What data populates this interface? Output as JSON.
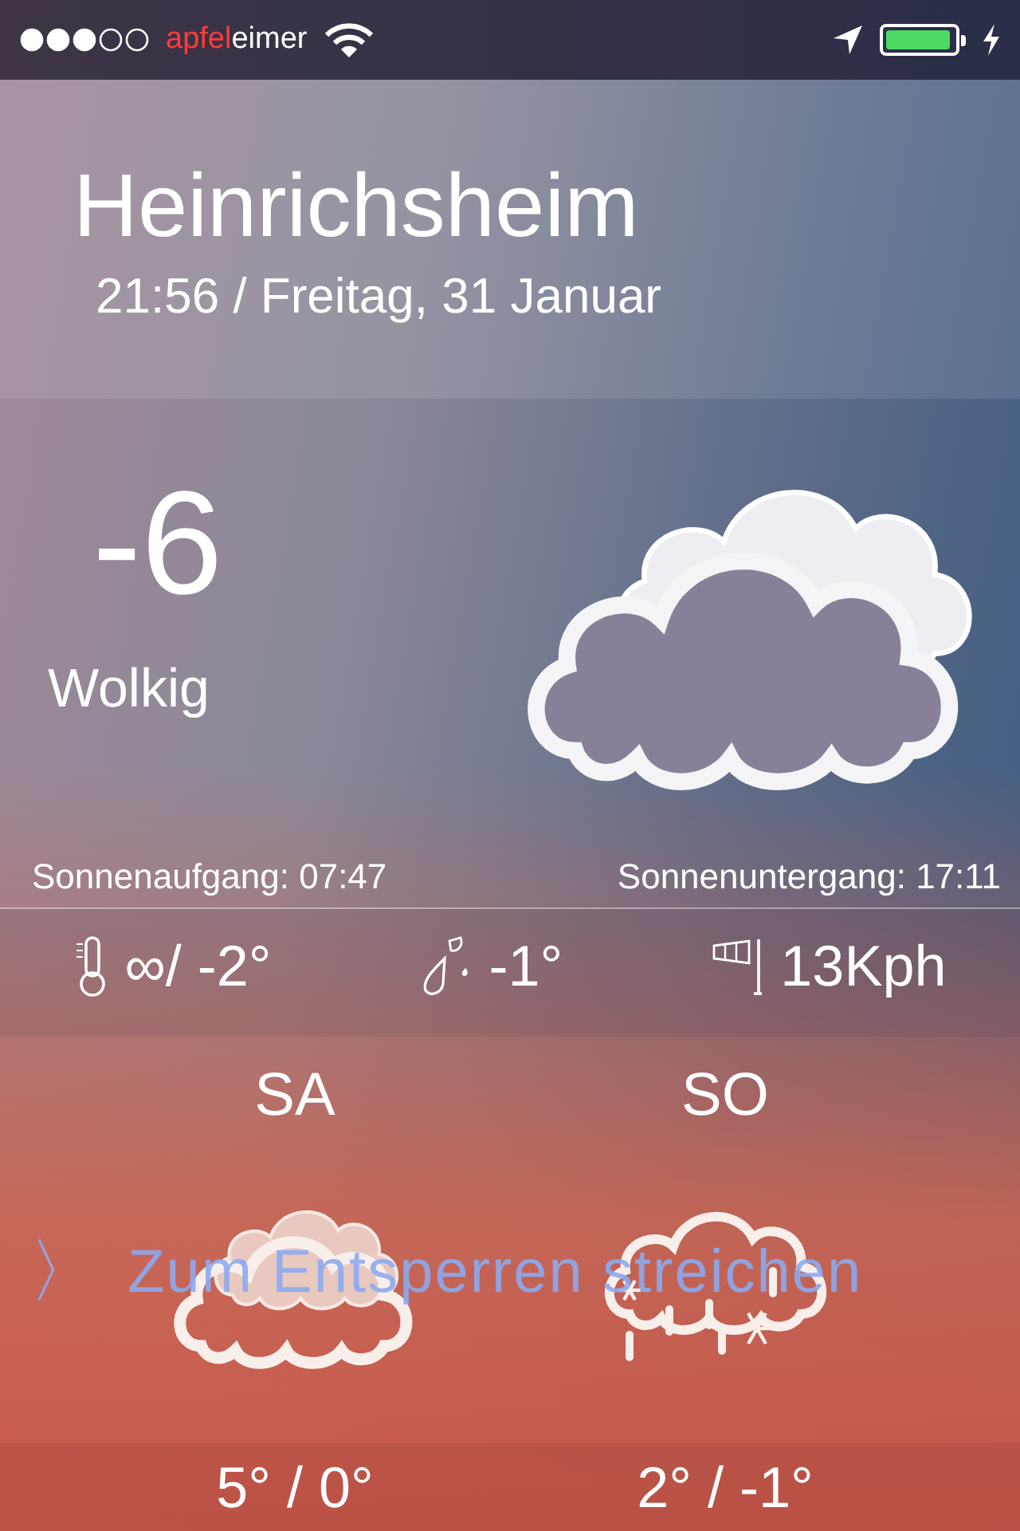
{
  "status_bar": {
    "carrier_parts": [
      "apfel",
      "eimer"
    ],
    "charging": true,
    "battery": {
      "level": 0.95
    }
  },
  "header": {
    "city": "Heinrichsheim",
    "datetime": "21:56 / Freitag, 31 Januar"
  },
  "current": {
    "temperature": "-6",
    "condition": "Wolkig",
    "sunrise": "Sonnenaufgang: 07:47",
    "sunset": "Sonnenuntergang: 17:11"
  },
  "stats": [
    {
      "kind": "thermometer",
      "value": "∞/ -2°"
    },
    {
      "kind": "drops",
      "value": "-1°"
    },
    {
      "kind": "wind",
      "value": "13Kph"
    }
  ],
  "forecast": [
    {
      "day": "SA",
      "kind": "cloudy",
      "temps": "5° / 0°"
    },
    {
      "day": "SO",
      "kind": "sleet",
      "temps": "2° / -1°"
    }
  ],
  "unlock": {
    "chevron": "〉",
    "label": "Zum Entsperren streichen"
  }
}
